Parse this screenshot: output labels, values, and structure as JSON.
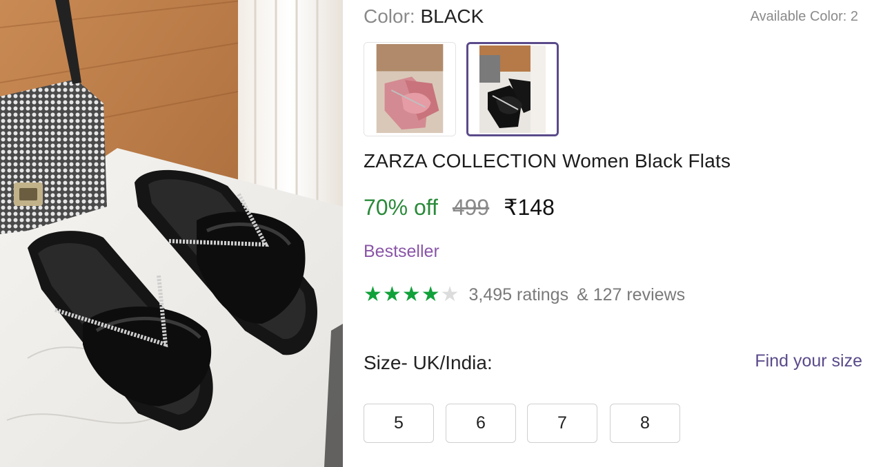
{
  "color": {
    "label": "Color:",
    "value": "BLACK"
  },
  "available": {
    "label": "Available Color:",
    "count": "2"
  },
  "swatches": [
    {
      "name": "pink-flats",
      "selected": false
    },
    {
      "name": "black-flats",
      "selected": true
    }
  ],
  "product": {
    "title": "ZARZA COLLECTION Women Black Flats"
  },
  "price": {
    "discount": "70% off",
    "mrp": "499",
    "selling": "₹148"
  },
  "badge": "Bestseller",
  "rating": {
    "stars": 4,
    "max": 5,
    "ratings_text": "3,495 ratings",
    "reviews_text": "& 127 reviews"
  },
  "size": {
    "label": "Size- UK/India:",
    "find_link": "Find your size",
    "options": [
      "5",
      "6",
      "7",
      "8"
    ]
  },
  "colors": {
    "accent": "#5a4a8a",
    "discount": "#2a8a3a",
    "star": "#11a13a",
    "bestseller": "#8a55a8"
  }
}
